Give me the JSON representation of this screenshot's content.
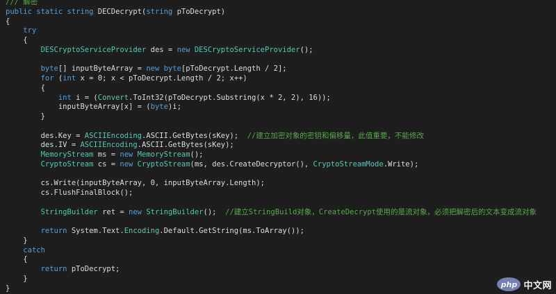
{
  "colors": {
    "background": "#1e1e1e",
    "keyword": "#569cd6",
    "type": "#4ec9b0",
    "comment": "#57a64a",
    "text": "#dcdcdc"
  },
  "code_lines": [
    [
      {
        "t": "cm",
        "v": "/// 解密"
      }
    ],
    [
      {
        "t": "kw",
        "v": "public"
      },
      {
        "t": "tx",
        "v": " "
      },
      {
        "t": "kw",
        "v": "static"
      },
      {
        "t": "tx",
        "v": " "
      },
      {
        "t": "kw",
        "v": "string"
      },
      {
        "t": "tx",
        "v": " DECDecrypt("
      },
      {
        "t": "kw",
        "v": "string"
      },
      {
        "t": "tx",
        "v": " pToDecrypt)"
      }
    ],
    [
      {
        "t": "tx",
        "v": "{"
      }
    ],
    [
      {
        "t": "tx",
        "v": "    "
      },
      {
        "t": "kw",
        "v": "try"
      }
    ],
    [
      {
        "t": "tx",
        "v": "    {"
      }
    ],
    [
      {
        "t": "tx",
        "v": "        "
      },
      {
        "t": "ty",
        "v": "DESCryptoServiceProvider"
      },
      {
        "t": "tx",
        "v": " des = "
      },
      {
        "t": "kw",
        "v": "new"
      },
      {
        "t": "tx",
        "v": " "
      },
      {
        "t": "ty",
        "v": "DESCryptoServiceProvider"
      },
      {
        "t": "tx",
        "v": "();"
      }
    ],
    [
      {
        "t": "tx",
        "v": ""
      }
    ],
    [
      {
        "t": "tx",
        "v": "        "
      },
      {
        "t": "kw",
        "v": "byte"
      },
      {
        "t": "tx",
        "v": "[] inputByteArray = "
      },
      {
        "t": "kw",
        "v": "new"
      },
      {
        "t": "tx",
        "v": " "
      },
      {
        "t": "kw",
        "v": "byte"
      },
      {
        "t": "tx",
        "v": "[pToDecrypt.Length / 2];"
      }
    ],
    [
      {
        "t": "tx",
        "v": "        "
      },
      {
        "t": "kw",
        "v": "for"
      },
      {
        "t": "tx",
        "v": " ("
      },
      {
        "t": "kw",
        "v": "int"
      },
      {
        "t": "tx",
        "v": " x = 0; x < pToDecrypt.Length / 2; x++)"
      }
    ],
    [
      {
        "t": "tx",
        "v": "        {"
      }
    ],
    [
      {
        "t": "tx",
        "v": "            "
      },
      {
        "t": "kw",
        "v": "int"
      },
      {
        "t": "tx",
        "v": " i = ("
      },
      {
        "t": "ty",
        "v": "Convert"
      },
      {
        "t": "tx",
        "v": ".ToInt32(pToDecrypt.Substring(x * 2, 2), 16));"
      }
    ],
    [
      {
        "t": "tx",
        "v": "            inputByteArray[x] = ("
      },
      {
        "t": "kw",
        "v": "byte"
      },
      {
        "t": "tx",
        "v": ")i;"
      }
    ],
    [
      {
        "t": "tx",
        "v": "        }"
      }
    ],
    [
      {
        "t": "tx",
        "v": ""
      }
    ],
    [
      {
        "t": "tx",
        "v": "        des.Key = "
      },
      {
        "t": "ty",
        "v": "ASCIIEncoding"
      },
      {
        "t": "tx",
        "v": ".ASCII.GetBytes(sKey);  "
      },
      {
        "t": "cm",
        "v": "//建立加密对象的密钥和偏移量，此值重要，不能修改"
      }
    ],
    [
      {
        "t": "tx",
        "v": "        des.IV = "
      },
      {
        "t": "ty",
        "v": "ASCIIEncoding"
      },
      {
        "t": "tx",
        "v": ".ASCII.GetBytes(sKey);"
      }
    ],
    [
      {
        "t": "tx",
        "v": "        "
      },
      {
        "t": "ty",
        "v": "MemoryStream"
      },
      {
        "t": "tx",
        "v": " ms = "
      },
      {
        "t": "kw",
        "v": "new"
      },
      {
        "t": "tx",
        "v": " "
      },
      {
        "t": "ty",
        "v": "MemoryStream"
      },
      {
        "t": "tx",
        "v": "();"
      }
    ],
    [
      {
        "t": "tx",
        "v": "        "
      },
      {
        "t": "ty",
        "v": "CryptoStream"
      },
      {
        "t": "tx",
        "v": " cs = "
      },
      {
        "t": "kw",
        "v": "new"
      },
      {
        "t": "tx",
        "v": " "
      },
      {
        "t": "ty",
        "v": "CryptoStream"
      },
      {
        "t": "tx",
        "v": "(ms, des.CreateDecryptor(), "
      },
      {
        "t": "ty",
        "v": "CryptoStreamMode"
      },
      {
        "t": "tx",
        "v": ".Write);"
      }
    ],
    [
      {
        "t": "tx",
        "v": ""
      }
    ],
    [
      {
        "t": "tx",
        "v": "        cs.Write(inputByteArray, 0, inputByteArray.Length);"
      }
    ],
    [
      {
        "t": "tx",
        "v": "        cs.FlushFinalBlock();"
      }
    ],
    [
      {
        "t": "tx",
        "v": ""
      }
    ],
    [
      {
        "t": "tx",
        "v": "        "
      },
      {
        "t": "ty",
        "v": "StringBuilder"
      },
      {
        "t": "tx",
        "v": " ret = "
      },
      {
        "t": "kw",
        "v": "new"
      },
      {
        "t": "tx",
        "v": " "
      },
      {
        "t": "ty",
        "v": "StringBuilder"
      },
      {
        "t": "tx",
        "v": "();  "
      },
      {
        "t": "cm",
        "v": "//建立StringBuild对象，CreateDecrypt使用的是流对象，必须把解密后的文本变成流对象"
      }
    ],
    [
      {
        "t": "tx",
        "v": ""
      }
    ],
    [
      {
        "t": "tx",
        "v": "        "
      },
      {
        "t": "kw",
        "v": "return"
      },
      {
        "t": "tx",
        "v": " System.Text."
      },
      {
        "t": "ty",
        "v": "Encoding"
      },
      {
        "t": "tx",
        "v": ".Default.GetString(ms.ToArray());"
      }
    ],
    [
      {
        "t": "tx",
        "v": "    }"
      }
    ],
    [
      {
        "t": "tx",
        "v": "    "
      },
      {
        "t": "kw",
        "v": "catch"
      }
    ],
    [
      {
        "t": "tx",
        "v": "    {"
      }
    ],
    [
      {
        "t": "tx",
        "v": "        "
      },
      {
        "t": "kw",
        "v": "return"
      },
      {
        "t": "tx",
        "v": " pToDecrypt;"
      }
    ],
    [
      {
        "t": "tx",
        "v": "    }"
      }
    ],
    [
      {
        "t": "tx",
        "v": "}"
      }
    ]
  ],
  "watermark": {
    "logo_text": "php",
    "site_text": "中文网"
  }
}
